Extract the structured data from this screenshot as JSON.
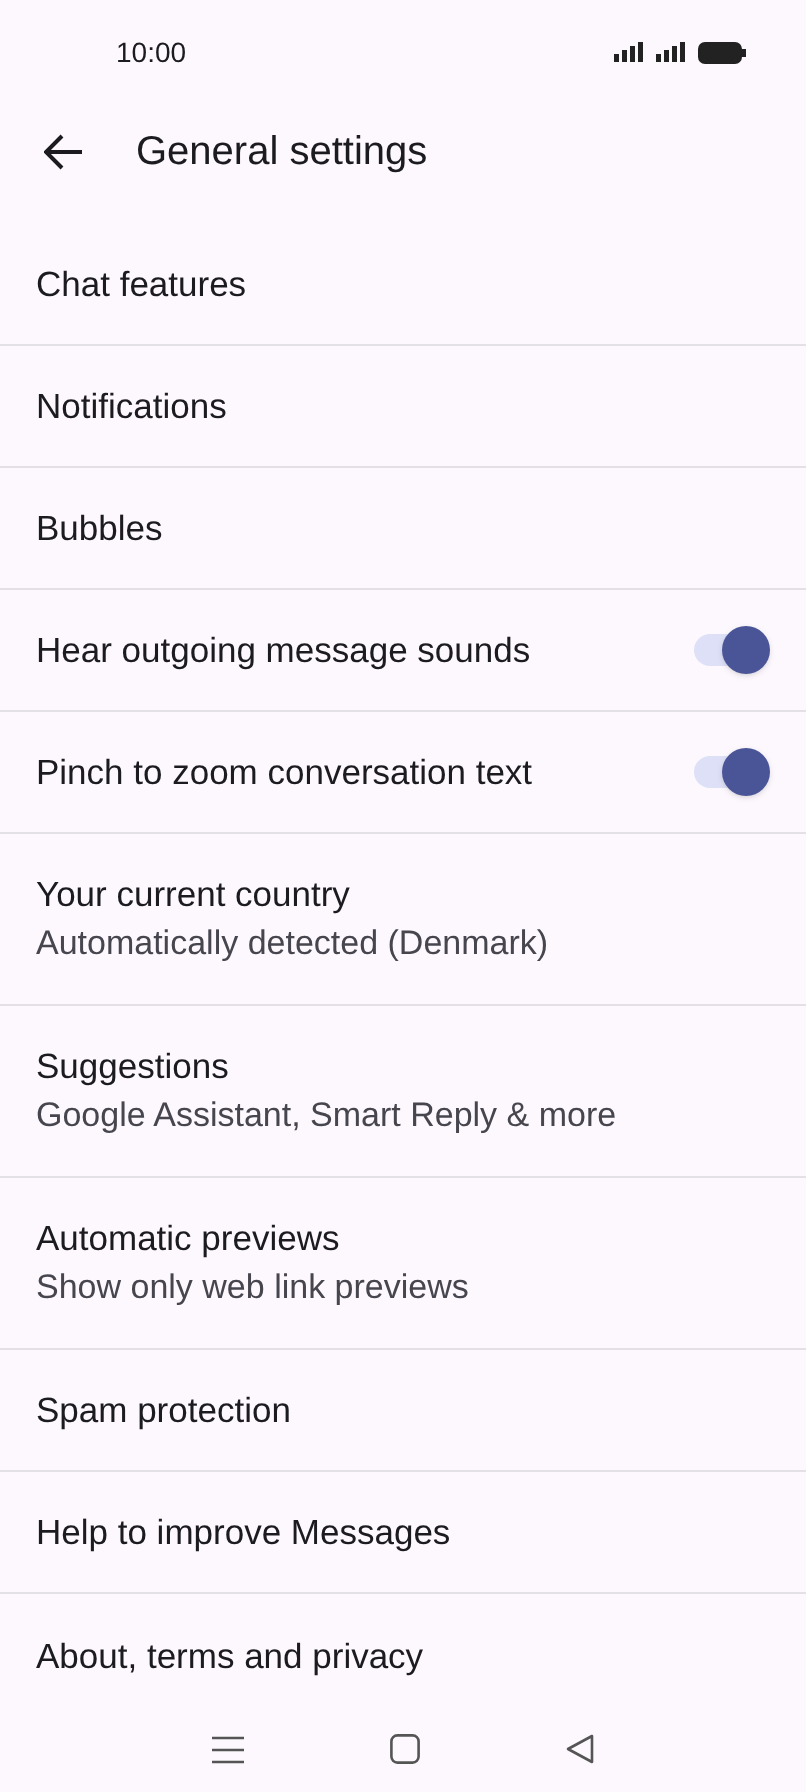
{
  "status_bar": {
    "time": "10:00"
  },
  "header": {
    "title": "General settings"
  },
  "settings": [
    {
      "kind": "plain",
      "title": "Chat features"
    },
    {
      "kind": "plain",
      "title": "Notifications"
    },
    {
      "kind": "plain",
      "title": "Bubbles"
    },
    {
      "kind": "toggle",
      "title": "Hear outgoing message sounds",
      "on": true
    },
    {
      "kind": "toggle",
      "title": "Pinch to zoom conversation text",
      "on": true
    },
    {
      "kind": "plain",
      "title": "Your current country",
      "subtitle": "Automatically detected (Denmark)"
    },
    {
      "kind": "plain",
      "title": "Suggestions",
      "subtitle": "Google Assistant, Smart Reply & more"
    },
    {
      "kind": "plain",
      "title": "Automatic previews",
      "subtitle": "Show only web link previews"
    },
    {
      "kind": "plain",
      "title": "Spam protection"
    },
    {
      "kind": "plain",
      "title": "Help to improve Messages"
    },
    {
      "kind": "plain",
      "title": "About, terms and privacy"
    }
  ]
}
